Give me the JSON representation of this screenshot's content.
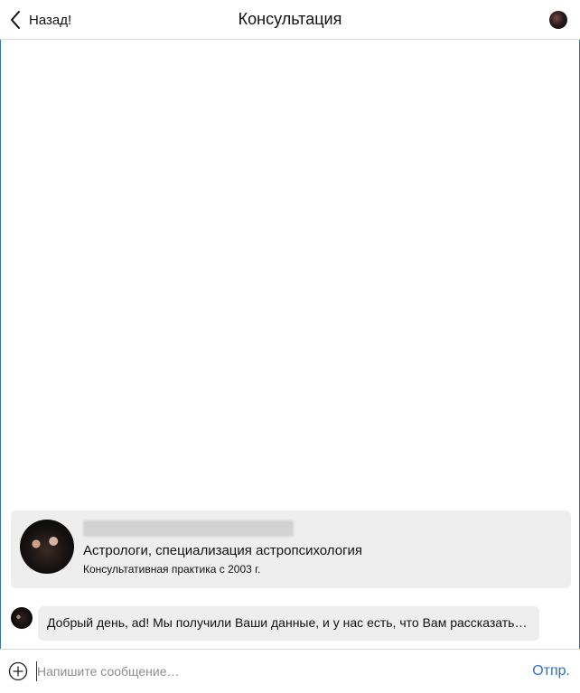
{
  "header": {
    "back_label": "Назад!",
    "title": "Консультация",
    "back_icon": "chevron-left-icon",
    "avatar": "user-avatar"
  },
  "profile": {
    "avatar": "expert-avatar",
    "specialization": "Астрологи, специализация астропсихология",
    "practice": "Консультативная практика с 2003 г."
  },
  "messages": [
    {
      "avatar": "expert-avatar",
      "text": "Добрый день, ad! Мы получили Ваши данные, и у нас есть, что Вам рассказать…"
    }
  ],
  "composer": {
    "attach_icon": "plus-circle-icon",
    "placeholder": "Напишите сообщение…",
    "value": "",
    "send_label": "Отпр."
  },
  "colors": {
    "accent": "#2f74c8",
    "frame_border": "#3b6fb6",
    "card_background": "#eeeeee"
  }
}
